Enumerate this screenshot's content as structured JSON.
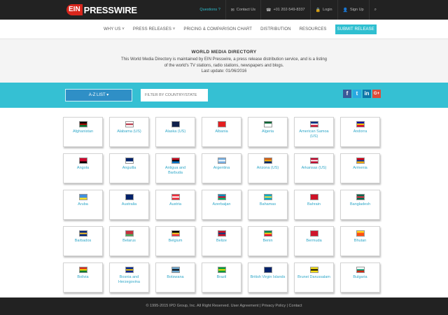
{
  "header": {
    "logo_mark": "EIN",
    "logo_text": "PRESSWIRE",
    "top_links": [
      {
        "label": "Questions ?",
        "icon": "question-icon"
      },
      {
        "label": "Contact Us",
        "icon": "envelope-icon"
      },
      {
        "label": "+01 202-549-8337",
        "icon": "phone-icon"
      },
      {
        "label": "Login",
        "icon": "lock-icon"
      },
      {
        "label": "Sign Up",
        "icon": "user-icon"
      },
      {
        "label": "",
        "icon": "search-icon"
      }
    ]
  },
  "nav": {
    "items": [
      "WHY US",
      "PRESS RELEASES",
      "PRICING & COMPARISON CHART",
      "DISTRIBUTION",
      "RESOURCES"
    ],
    "cta": "SUBMIT RELEASE"
  },
  "hero": {
    "title": "WORLD MEDIA DIRECTORY",
    "description": "This World Media Directory is maintained by EIN Presswire, a press release distribution service, and is a listing of the world's TV stations, radio stations, newspapers and blogs.",
    "updated": "Last update: 01/06/2016"
  },
  "filters": {
    "az_label": "A-Z LIST",
    "search_placeholder": "FILTER BY COUNTRY/STATE"
  },
  "social": [
    "f",
    "t",
    "in",
    "G+"
  ],
  "countries": [
    {
      "name": "Afghanistan",
      "flag": [
        "#000",
        "#b80000",
        "#007a36"
      ]
    },
    {
      "name": "Alabama (US)",
      "flag": [
        "#fff",
        "#b22234",
        "#fff"
      ]
    },
    {
      "name": "Alaska (US)",
      "flag": [
        "#0f204b",
        "#0f204b",
        "#0f204b"
      ]
    },
    {
      "name": "Albania",
      "flag": [
        "#e41e20",
        "#e41e20",
        "#e41e20"
      ]
    },
    {
      "name": "Algeria",
      "flag": [
        "#006233",
        "#fff",
        "#fff"
      ]
    },
    {
      "name": "American Samoa (US)",
      "flag": [
        "#002b7f",
        "#fff",
        "#c8102e"
      ]
    },
    {
      "name": "Andorra",
      "flag": [
        "#10069f",
        "#fedf00",
        "#d50032"
      ]
    },
    {
      "name": "Angola",
      "flag": [
        "#cc092f",
        "#cc092f",
        "#000"
      ]
    },
    {
      "name": "Anguilla",
      "flag": [
        "#012169",
        "#012169",
        "#fff"
      ]
    },
    {
      "name": "Antigua and Barbuda",
      "flag": [
        "#ce1126",
        "#000",
        "#0072c6"
      ]
    },
    {
      "name": "Argentina",
      "flag": [
        "#74acdf",
        "#fff",
        "#74acdf"
      ]
    },
    {
      "name": "Arizona (US)",
      "flag": [
        "#ce5c17",
        "#f6b40e",
        "#002868"
      ]
    },
    {
      "name": "Arkansas (US)",
      "flag": [
        "#be0b31",
        "#fff",
        "#be0b31"
      ]
    },
    {
      "name": "Armenia",
      "flag": [
        "#d90012",
        "#0033a0",
        "#f2a800"
      ]
    },
    {
      "name": "Aruba",
      "flag": [
        "#418fde",
        "#418fde",
        "#fbe122"
      ]
    },
    {
      "name": "Australia",
      "flag": [
        "#012169",
        "#012169",
        "#012169"
      ]
    },
    {
      "name": "Austria",
      "flag": [
        "#ed2939",
        "#fff",
        "#ed2939"
      ]
    },
    {
      "name": "Azerbaijan",
      "flag": [
        "#0092bc",
        "#e4002b",
        "#00af66"
      ]
    },
    {
      "name": "Bahamas",
      "flag": [
        "#00abc9",
        "#fae042",
        "#00abc9"
      ]
    },
    {
      "name": "Bahrain",
      "flag": [
        "#ce1126",
        "#ce1126",
        "#ce1126"
      ]
    },
    {
      "name": "Bangladesh",
      "flag": [
        "#006a4e",
        "#f42a41",
        "#006a4e"
      ]
    },
    {
      "name": "Barbados",
      "flag": [
        "#00267f",
        "#ffc726",
        "#00267f"
      ]
    },
    {
      "name": "Belarus",
      "flag": [
        "#c8313e",
        "#c8313e",
        "#4aa657"
      ]
    },
    {
      "name": "Belgium",
      "flag": [
        "#000",
        "#fdda24",
        "#ef3340"
      ]
    },
    {
      "name": "Belize",
      "flag": [
        "#ce1126",
        "#003f87",
        "#ce1126"
      ]
    },
    {
      "name": "Benin",
      "flag": [
        "#008751",
        "#fcd116",
        "#e8112d"
      ]
    },
    {
      "name": "Bermuda",
      "flag": [
        "#cf142b",
        "#cf142b",
        "#cf142b"
      ]
    },
    {
      "name": "Bhutan",
      "flag": [
        "#ffd520",
        "#ff4e12",
        "#ff4e12"
      ]
    },
    {
      "name": "Bolivia",
      "flag": [
        "#d52b1e",
        "#f9e300",
        "#007934"
      ]
    },
    {
      "name": "Bosnia and Herzegovina",
      "flag": [
        "#002395",
        "#fecb00",
        "#002395"
      ]
    },
    {
      "name": "Botswana",
      "flag": [
        "#6da9d2",
        "#000",
        "#6da9d2"
      ]
    },
    {
      "name": "Brazil",
      "flag": [
        "#009c3b",
        "#ffdf00",
        "#009c3b"
      ]
    },
    {
      "name": "British Virgin Islands",
      "flag": [
        "#012169",
        "#012169",
        "#012169"
      ]
    },
    {
      "name": "Brunei Darussalam",
      "flag": [
        "#f7e017",
        "#000",
        "#f7e017"
      ]
    },
    {
      "name": "Bulgaria",
      "flag": [
        "#fff",
        "#00966e",
        "#d62612"
      ]
    }
  ],
  "footer": {
    "text": "© 1995-2015 IPD Group, Inc. All Right Reserved. User Agreement | Privacy Policy | Contact"
  }
}
